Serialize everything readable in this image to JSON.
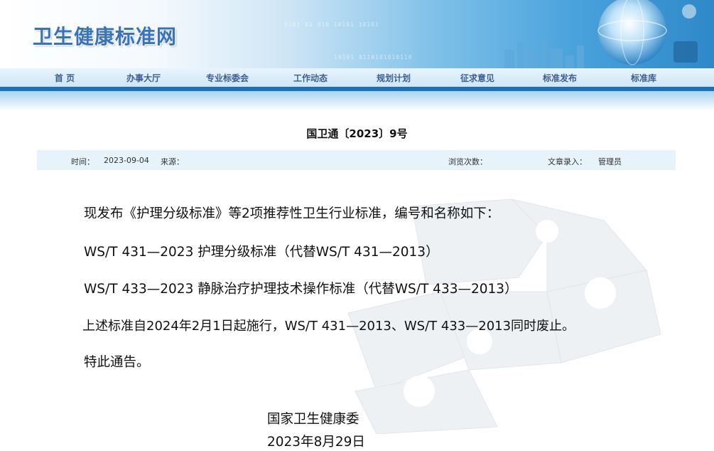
{
  "site": {
    "title": "卫生健康标准网"
  },
  "banner": {
    "binary_text_1": "0101 01 010 10101 10101",
    "binary_text_2": "10101 0110101010110"
  },
  "nav": {
    "items": [
      {
        "label": "首  页"
      },
      {
        "label": "办事大厅"
      },
      {
        "label": "专业标委会"
      },
      {
        "label": "工作动态"
      },
      {
        "label": "规划计划"
      },
      {
        "label": "征求意见"
      },
      {
        "label": "标准发布"
      },
      {
        "label": "标准库"
      }
    ]
  },
  "article": {
    "title": "国卫通〔2023〕9号",
    "meta": {
      "time_label": "时间：",
      "time_value": "2023-09-04",
      "source_label": "来源：",
      "views_label": "浏览次数：",
      "author_label": "文章录入：",
      "author_value": "管理员"
    },
    "paragraphs": [
      "现发布《护理分级标准》等2项推荐性卫生行业标准，编号和名称如下：",
      "WS/T 431—2023 护理分级标准（代替WS/T 431—2013）",
      "WS/T 433—2023 静脉治疗护理技术操作标准（代替WS/T 433—2013）",
      "上述标准自2024年2月1日起施行，WS/T 431—2013、WS/T 433—2013同时废止。",
      "特此通告。"
    ],
    "signature": {
      "org": "国家卫生健康委",
      "date": "2023年8月29日"
    }
  }
}
